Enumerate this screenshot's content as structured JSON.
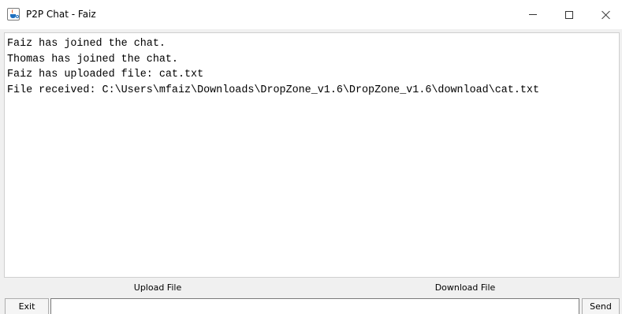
{
  "window": {
    "title": "P2P Chat - Faiz",
    "app_icon": "java-cup-icon"
  },
  "chat": {
    "lines": [
      "Faiz has joined the chat.",
      "Thomas has joined the chat.",
      "Faiz has uploaded file: cat.txt",
      "File received: C:\\Users\\mfaiz\\Downloads\\DropZone_v1.6\\DropZone_v1.6\\download\\cat.txt"
    ]
  },
  "actions": {
    "upload_label": "Upload File",
    "download_label": "Download File"
  },
  "footer": {
    "exit_label": "Exit",
    "message_value": "",
    "send_label": "Send"
  }
}
